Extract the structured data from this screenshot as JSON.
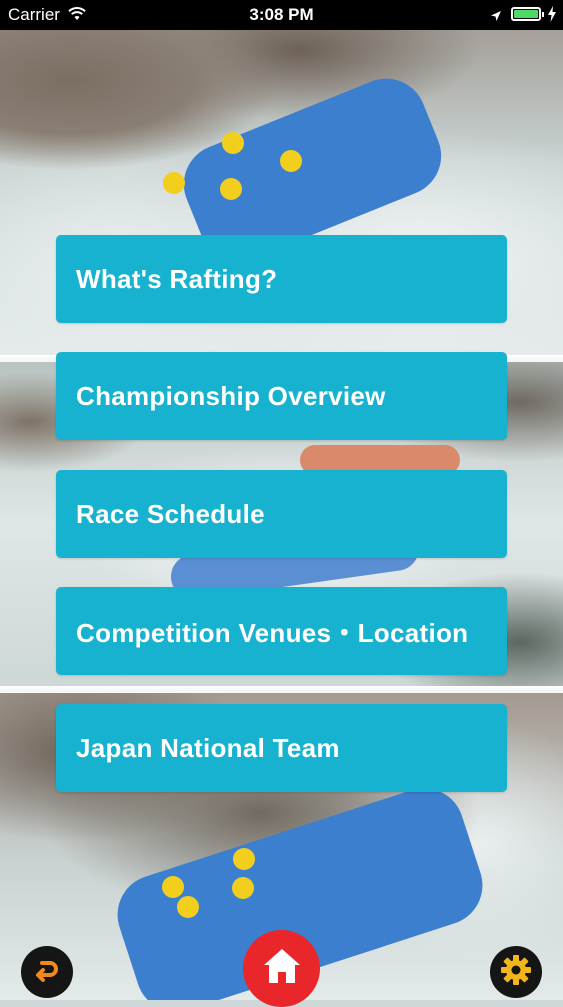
{
  "status_bar": {
    "carrier": "Carrier",
    "time": "3:08 PM"
  },
  "menu": {
    "items": [
      {
        "label": "What's Rafting?"
      },
      {
        "label": "Championship Overview"
      },
      {
        "label": "Race Schedule"
      },
      {
        "label": "Competition Venues・Location"
      },
      {
        "label": "Japan National Team"
      }
    ]
  },
  "bottom_bar": {
    "back_icon": "back-arrow-icon",
    "home_icon": "home-icon",
    "settings_icon": "gear-icon"
  },
  "colors": {
    "menu_button": "#17b2cf",
    "home_button": "#e9272b",
    "round_button": "#151515",
    "accent_orange": "#f08a1c",
    "gear_yellow": "#f2b51b"
  }
}
